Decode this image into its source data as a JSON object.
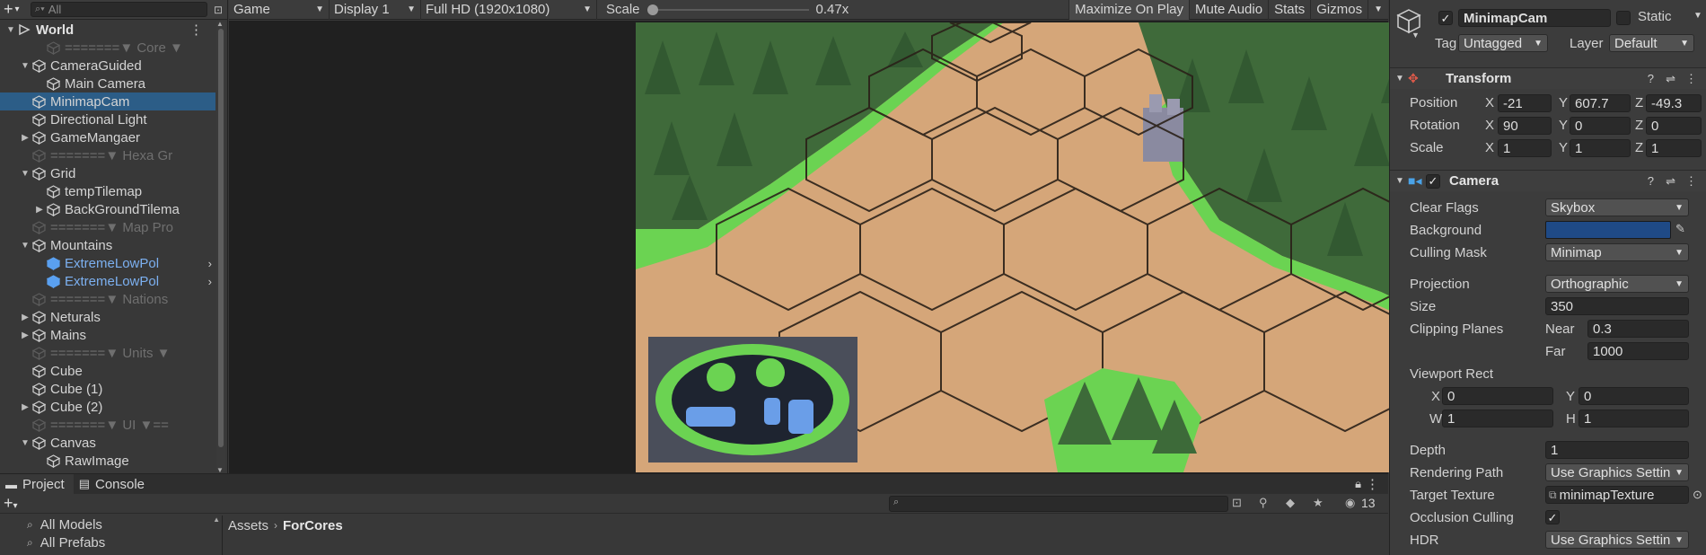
{
  "hierarchy": {
    "search_placeholder": "All",
    "rows": [
      {
        "label": "World",
        "style": "bold"
      },
      {
        "label": "=======▼ Core ▼",
        "style": "dim"
      },
      {
        "label": "CameraGuided",
        "style": "normal"
      },
      {
        "label": "Main Camera",
        "style": "normal"
      },
      {
        "label": "MinimapCam",
        "style": "normal"
      },
      {
        "label": "Directional Light",
        "style": "normal"
      },
      {
        "label": "GameMangaer",
        "style": "normal"
      },
      {
        "label": "=======▼ Hexa Gr",
        "style": "dim"
      },
      {
        "label": "Grid",
        "style": "normal"
      },
      {
        "label": "tempTilemap",
        "style": "normal"
      },
      {
        "label": "BackGroundTilema",
        "style": "normal"
      },
      {
        "label": "=======▼ Map Pro",
        "style": "dim"
      },
      {
        "label": "Mountains",
        "style": "normal"
      },
      {
        "label": "ExtremeLowPol",
        "style": "blue"
      },
      {
        "label": "ExtremeLowPol",
        "style": "blue"
      },
      {
        "label": "=======▼ Nations",
        "style": "dim"
      },
      {
        "label": "Neturals",
        "style": "normal"
      },
      {
        "label": "Mains",
        "style": "normal"
      },
      {
        "label": "=======▼ Units ▼",
        "style": "dim"
      },
      {
        "label": "Cube",
        "style": "normal"
      },
      {
        "label": "Cube (1)",
        "style": "normal"
      },
      {
        "label": "Cube (2)",
        "style": "normal"
      },
      {
        "label": "=======▼ UI ▼==",
        "style": "dim"
      },
      {
        "label": "Canvas",
        "style": "normal"
      },
      {
        "label": "RawImage",
        "style": "normal"
      }
    ]
  },
  "game_toolbar": {
    "view": "Game",
    "display": "Display 1",
    "resolution": "Full HD (1920x1080)",
    "scale_label": "Scale",
    "scale_value": "0.47x",
    "maximize": "Maximize On Play",
    "mute": "Mute Audio",
    "stats": "Stats",
    "gizmos": "Gizmos"
  },
  "inspector": {
    "object_name": "MinimapCam",
    "static_label": "Static",
    "tag_label": "Tag",
    "tag_value": "Untagged",
    "layer_label": "Layer",
    "layer_value": "Default",
    "transform": {
      "title": "Transform",
      "position_label": "Position",
      "pos_x": "-21",
      "pos_y": "607.7",
      "pos_z": "-49.3",
      "rotation_label": "Rotation",
      "rot_x": "90",
      "rot_y": "0",
      "rot_z": "0",
      "scale_label": "Scale",
      "scale_x": "1",
      "scale_y": "1",
      "scale_z": "1"
    },
    "camera": {
      "title": "Camera",
      "clear_flags_label": "Clear Flags",
      "clear_flags": "Skybox",
      "background_label": "Background",
      "background_color": "#1f4a86",
      "culling_mask_label": "Culling Mask",
      "culling_mask": "Minimap",
      "projection_label": "Projection",
      "projection": "Orthographic",
      "size_label": "Size",
      "size": "350",
      "clipping_label": "Clipping Planes",
      "near_label": "Near",
      "near": "0.3",
      "far_label": "Far",
      "far": "1000",
      "viewport_label": "Viewport Rect",
      "vp_x": "0",
      "vp_y": "0",
      "vp_w": "1",
      "vp_h": "1",
      "depth_label": "Depth",
      "depth": "1",
      "rendering_path_label": "Rendering Path",
      "rendering_path": "Use Graphics Settin",
      "target_texture_label": "Target Texture",
      "target_texture": "minimapTexture",
      "occlusion_label": "Occlusion Culling",
      "hdr_label": "HDR",
      "hdr": "Use Graphics Settin"
    }
  },
  "bottom": {
    "tab_project": "Project",
    "tab_console": "Console",
    "hidden_count": "13",
    "favorites": [
      "All Models",
      "All Prefabs"
    ],
    "breadcrumb_root": "Assets",
    "breadcrumb_current": "ForCores"
  }
}
